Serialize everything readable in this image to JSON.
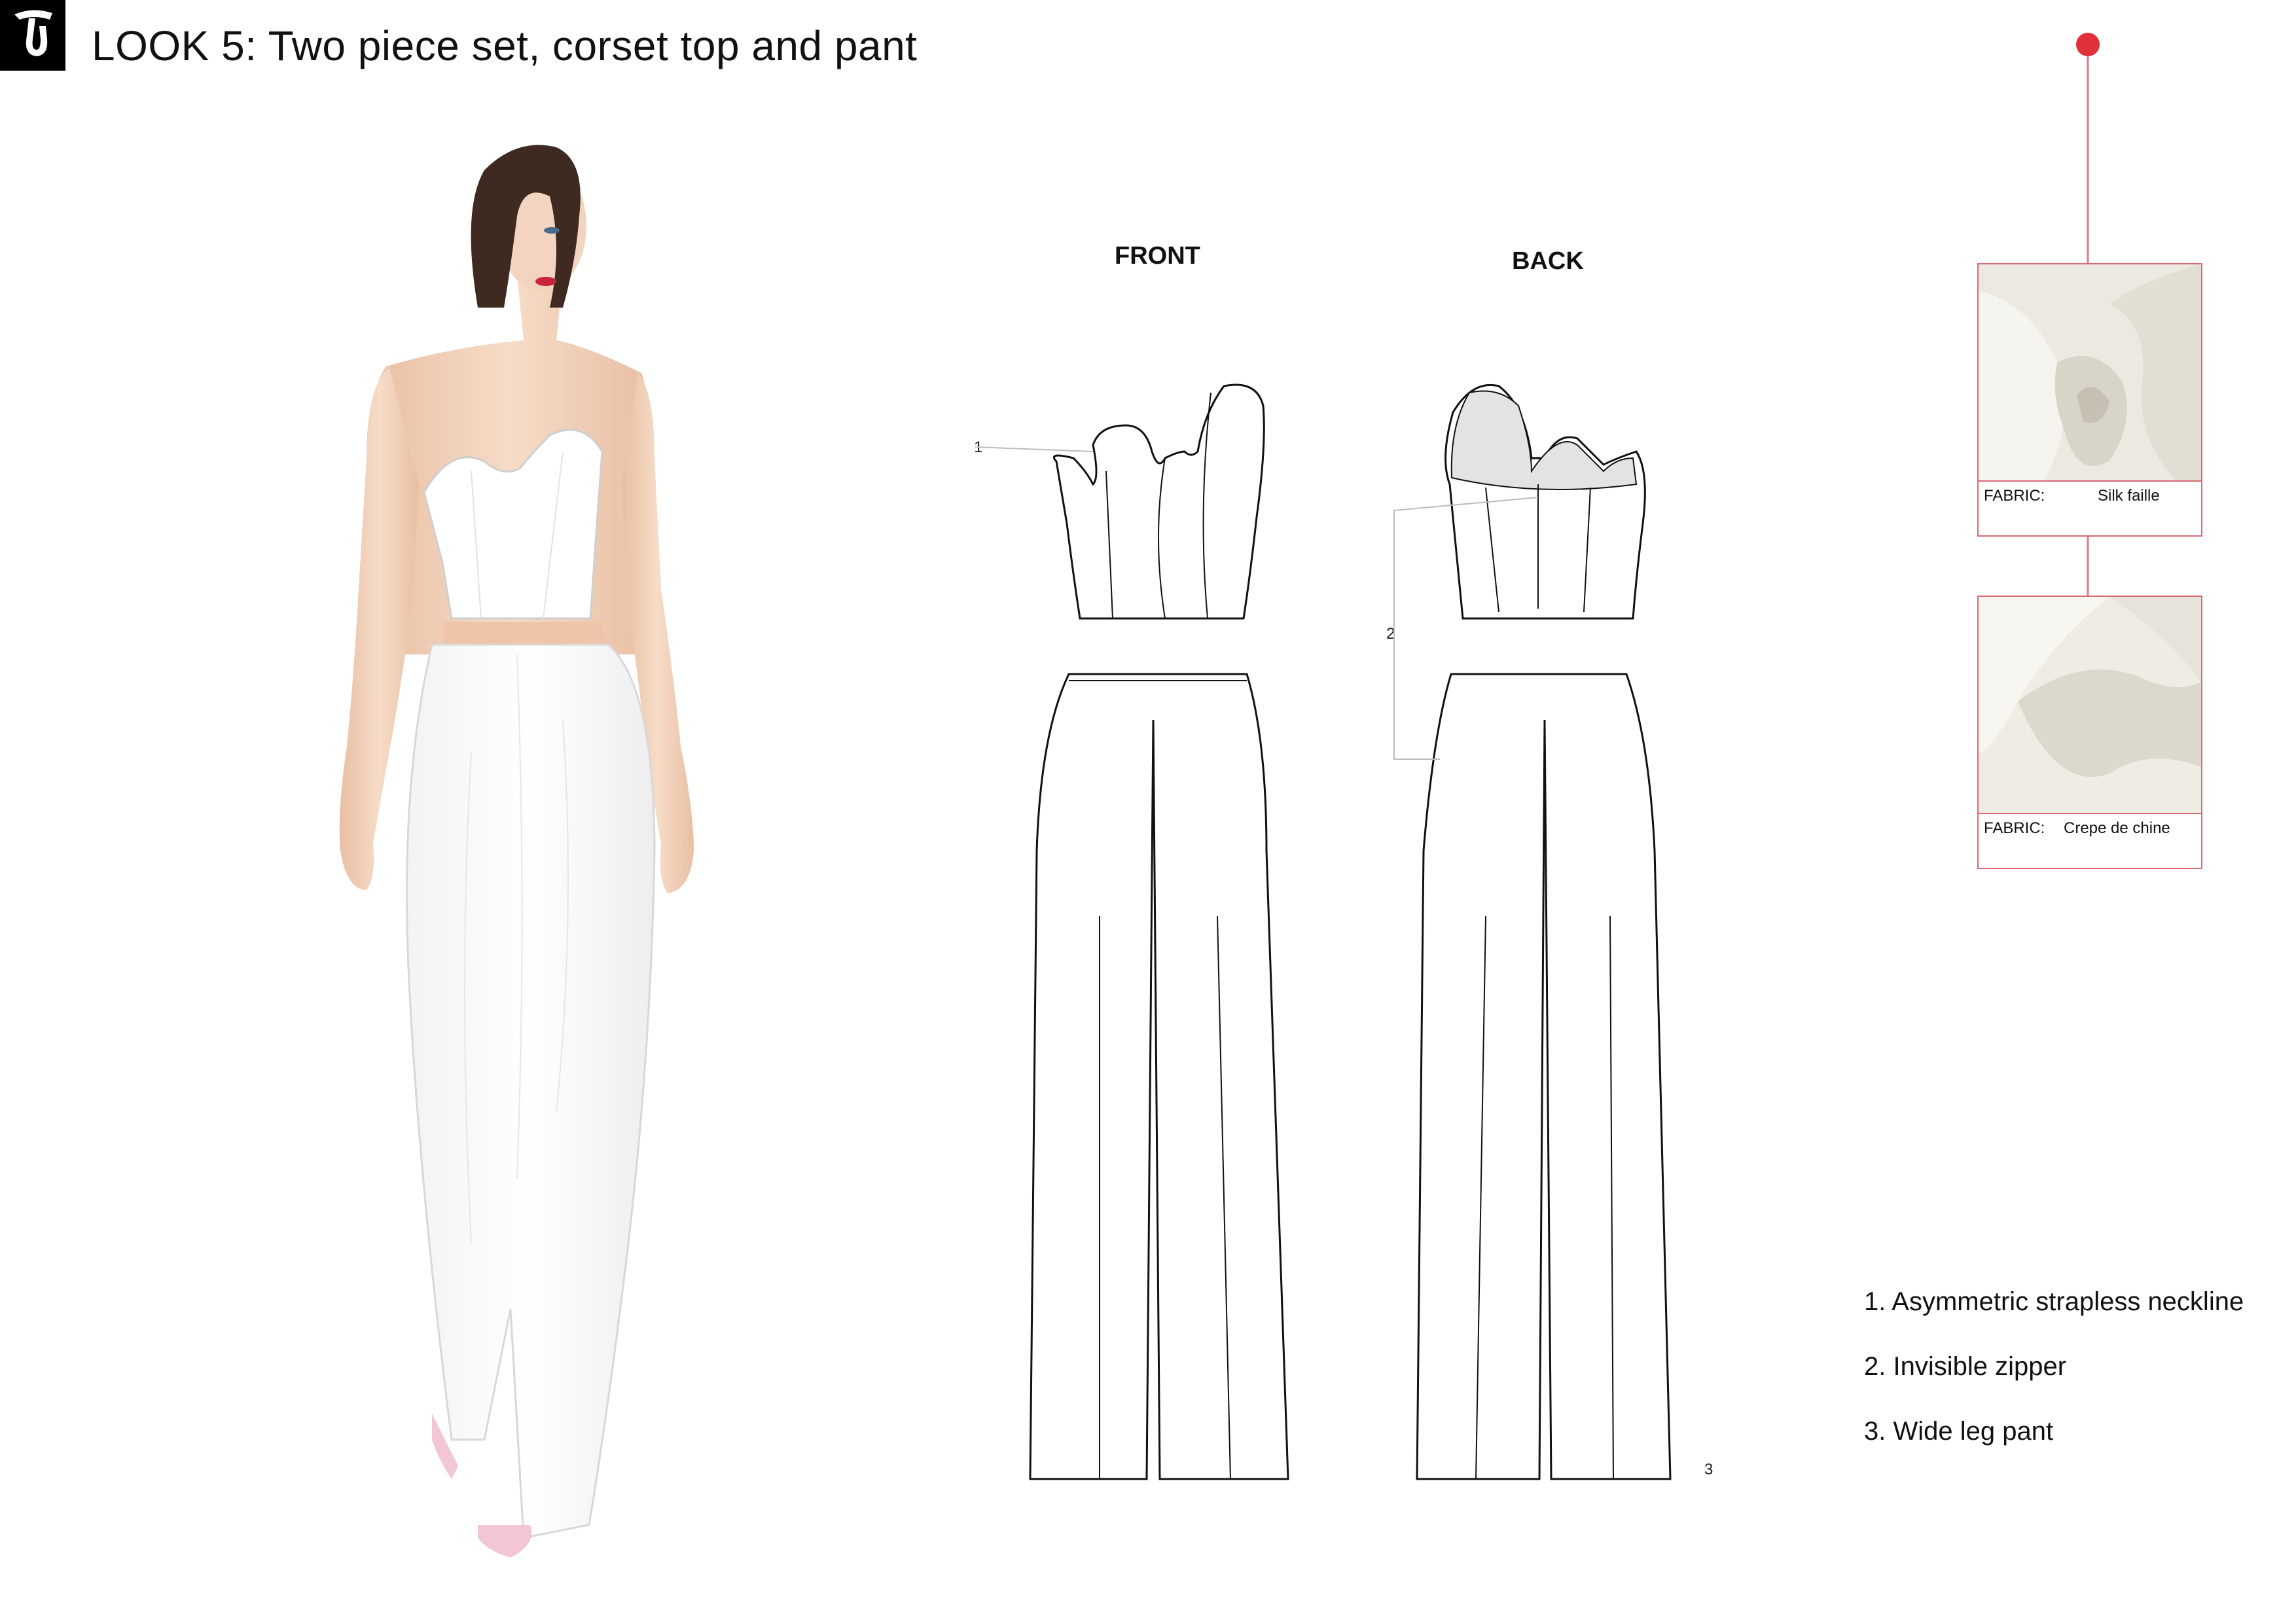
{
  "header": {
    "title": "LOOK 5: Two piece set, corset top and pant"
  },
  "views": {
    "front_label": "FRONT",
    "back_label": "BACK"
  },
  "callouts": {
    "one": "1",
    "two": "2",
    "three": "3"
  },
  "notes": [
    "1. Asymmetric strapless neckline",
    "2. Invisible zipper",
    "3. Wide leg pant"
  ],
  "fabrics": [
    {
      "key": "FABRIC:",
      "value": "Silk faille"
    },
    {
      "key": "FABRIC:",
      "value": "Crepe de chine"
    }
  ],
  "colors": {
    "accent_red": "#e0303a",
    "swatch_border": "#d96a72",
    "skin": "#f1cdb3",
    "hair": "#3e2a20",
    "garment": "#ffffff",
    "shoes": "#f2c6d2"
  }
}
